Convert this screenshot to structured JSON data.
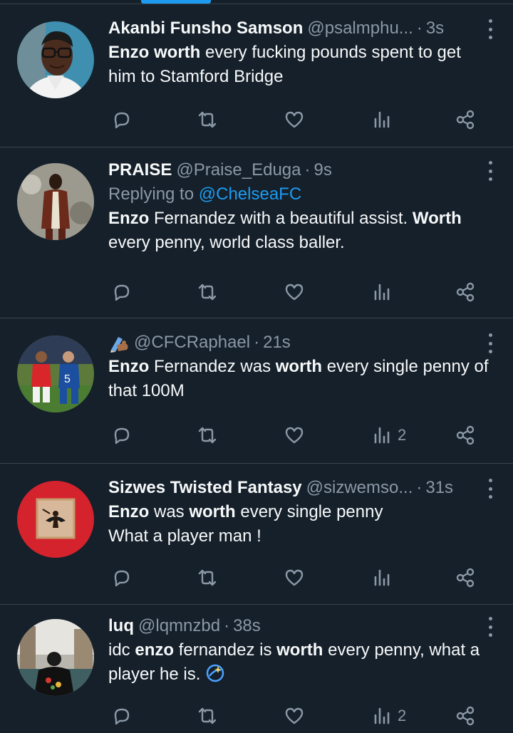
{
  "tweets": [
    {
      "name": "Akanbi Funsho Samson",
      "handle": "@psalmphu...",
      "time": "3s",
      "body_lines": [
        [
          {
            "b": "Enzo worth"
          },
          {
            "t": " every fucking pounds spent to get"
          }
        ],
        [
          {
            "t": "him to  Stamford Bridge"
          }
        ]
      ],
      "views": ""
    },
    {
      "name": "PRAISE",
      "handle": "@Praise_Eduga",
      "time": "9s",
      "reply_prefix": "Replying to ",
      "reply_mention": "@ChelseaFC",
      "body_lines": [
        [
          {
            "b": "Enzo"
          },
          {
            "t": " Fernandez with a beautiful assist. "
          },
          {
            "b": "Worth"
          }
        ],
        [
          {
            "t": "every penny, world class baller."
          }
        ]
      ],
      "views": ""
    },
    {
      "name": "",
      "name_emoji": "writing-hand-icon",
      "handle": "@CFCRaphael",
      "time": "21s",
      "body_lines": [
        [
          {
            "b": "Enzo"
          },
          {
            "t": " Fernandez was "
          },
          {
            "b": "worth"
          },
          {
            "t": " every single penny of"
          }
        ],
        [
          {
            "t": "that 100M"
          }
        ]
      ],
      "views": "2"
    },
    {
      "name": "Sizwes Twisted Fantasy",
      "handle": "@sizwemso...",
      "time": "31s",
      "body_lines": [
        [
          {
            "b": "Enzo"
          },
          {
            "t": " was "
          },
          {
            "b": "worth"
          },
          {
            "t": " every single penny"
          }
        ],
        [
          {
            "t": "What a player man !"
          }
        ]
      ],
      "views": ""
    },
    {
      "name": "luq",
      "handle": "@lqmnzbd",
      "time": "38s",
      "body_lines": [
        [
          {
            "t": "idc "
          },
          {
            "b": "enzo"
          },
          {
            "t": " fernandez is "
          },
          {
            "b": "worth"
          },
          {
            "t": " every penny, what a"
          }
        ],
        [
          {
            "t": "player he is. "
          }
        ]
      ],
      "views": "2"
    }
  ],
  "icons": {
    "reply": "reply-icon",
    "retweet": "retweet-icon",
    "like": "heart-icon",
    "views": "views-icon",
    "share": "share-icon",
    "more": "more-icon"
  },
  "colors": {
    "background": "#15202b",
    "divider": "#38444d",
    "secondary_text": "#8b98a5",
    "accent": "#1d9bf0"
  }
}
